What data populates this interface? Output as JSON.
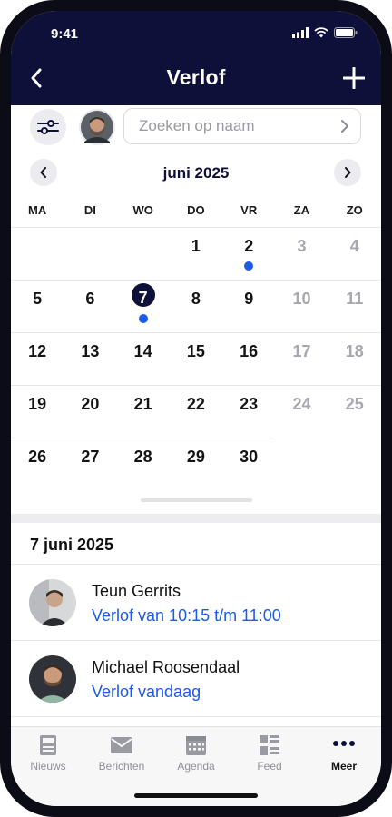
{
  "status": {
    "time": "9:41"
  },
  "nav": {
    "title": "Verlof",
    "back_icon": "chevron-left-icon",
    "add_icon": "plus-icon"
  },
  "filter": {
    "filter_icon": "sliders-icon"
  },
  "search": {
    "placeholder": "Zoeken op naam",
    "value": ""
  },
  "calendar": {
    "month_label": "juni 2025",
    "weekdays": [
      "MA",
      "DI",
      "WO",
      "DO",
      "VR",
      "ZA",
      "ZO"
    ],
    "weeks": [
      [
        "",
        "",
        "",
        "1",
        "2",
        "3",
        "4"
      ],
      [
        "5",
        "6",
        "7",
        "8",
        "9",
        "10",
        "11"
      ],
      [
        "12",
        "13",
        "14",
        "15",
        "16",
        "17",
        "18"
      ],
      [
        "19",
        "20",
        "21",
        "22",
        "23",
        "24",
        "25"
      ],
      [
        "26",
        "27",
        "28",
        "29",
        "30",
        "",
        ""
      ]
    ],
    "selected_day": "7",
    "days_with_leave": [
      "2",
      "7"
    ]
  },
  "list": {
    "date_header": "7 juni 2025",
    "items": [
      {
        "name": "Teun Gerrits",
        "detail": "Verlof van 10:15 t/m 11:00"
      },
      {
        "name": "Michael Roosendaal",
        "detail": "Verlof vandaag"
      }
    ]
  },
  "tabs": [
    {
      "label": "Nieuws",
      "icon": "newspaper-icon"
    },
    {
      "label": "Berichten",
      "icon": "envelope-icon"
    },
    {
      "label": "Agenda",
      "icon": "calendar-icon"
    },
    {
      "label": "Feed",
      "icon": "feed-icon"
    },
    {
      "label": "Meer",
      "icon": "more-dots-icon",
      "active": true
    }
  ],
  "colors": {
    "navy": "#0e1039",
    "accent": "#1a5bea"
  }
}
